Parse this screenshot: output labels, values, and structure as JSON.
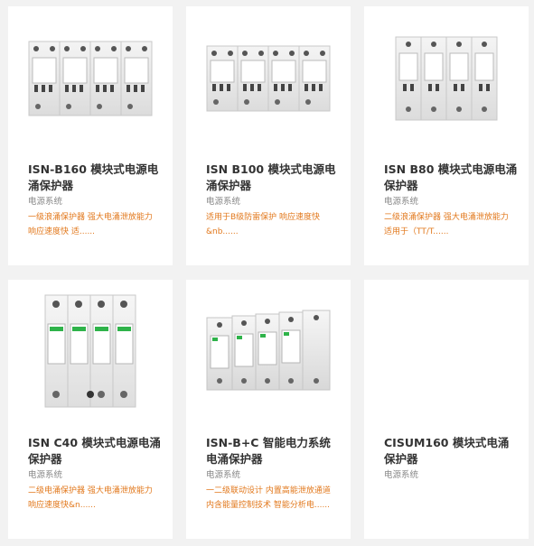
{
  "products": [
    {
      "title": "ISN-B160 模块式电源电涌保护器",
      "category": "电源系统",
      "description": "一级浪涌保护器 强大电涌泄放能力 响应速度快 适......",
      "image": "spd-4pole-wide-image"
    },
    {
      "title": "ISN B100 模块式电源电涌保护器",
      "category": "电源系统",
      "description": "适用于B级防雷保护 响应速度快 &nb......",
      "image": "spd-4pole-wide-image"
    },
    {
      "title": "ISN B80 模块式电源电涌保护器",
      "category": "电源系统",
      "description": "二级浪涌保护器 强大电涌泄放能力 适用于（TT/T......",
      "image": "spd-4pole-narrow-image"
    },
    {
      "title": "ISN C40 模块式电源电涌保护器",
      "category": "电源系统",
      "description": "二级电涌保护器 强大电涌泄放能力 响应速度快&n......",
      "image": "spd-4pole-tall-image"
    },
    {
      "title": "ISN-B+C 智能电力系统电涌保护器",
      "category": "电源系统",
      "description": "一二级联动设计 内置高能泄放通道 内含能量控制技术 智能分析电......",
      "image": "spd-5pole-smart-image"
    },
    {
      "title": "CISUM160 模块式电涌保护器",
      "category": "电源系统",
      "description": "",
      "image": ""
    }
  ],
  "colors": {
    "background": "#f2f2f2",
    "card": "#ffffff",
    "title": "#333333",
    "category": "#888888",
    "description_accent": "#e2781c"
  }
}
